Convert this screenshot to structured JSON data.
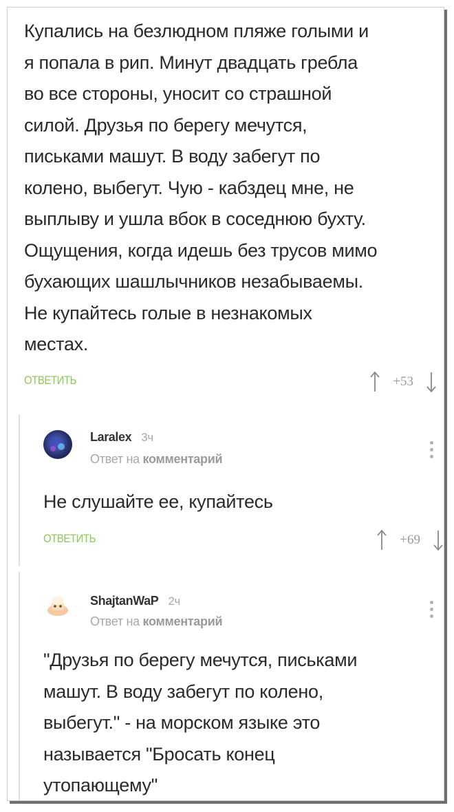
{
  "post": {
    "lines": [
      "Купались на безлюдном пляже голыми и",
      "я попала в рип. Минут двадцать гребла",
      "во все стороны, уносит со страшной",
      "силой. Друзья по берегу мечутся,",
      "письками машут.  В воду забегут по",
      "колено, выбегут.  Чую - кабздец мне, не",
      "выплыву и ушла вбок в соседнюю бухту.",
      "Ощущения, когда идешь без трусов мимо",
      "бухающих шашлычников незабываемы.",
      "Не купайтесь голые в незнакомых",
      "местах."
    ],
    "reply_label": "ОТВЕТИТЬ",
    "score": "+53"
  },
  "comments": [
    {
      "author": "Laralex",
      "time": "3ч",
      "reply_prefix": "Ответ на",
      "reply_target": "комментарий",
      "lines": [
        "Не слушайте ее, купайтесь"
      ],
      "reply_label": "ОТВЕТИТЬ",
      "score": "+69"
    },
    {
      "author": "ShajtanWaP",
      "time": "2ч",
      "reply_prefix": "Ответ на",
      "reply_target": "комментарий",
      "lines": [
        "\"Друзья по берегу мечутся, письками",
        "машут. В воду забегут по колено,",
        "выбегут.\" - на морском языке это",
        "называется \"Бросать конец",
        "утопающему\""
      ]
    }
  ],
  "colors": {
    "reply_link": "#8ac858",
    "text": "#2a2a2a",
    "muted": "#a8a8a8"
  },
  "icons": [
    "upvote-arrow-icon",
    "downvote-arrow-icon",
    "more-vertical-icon",
    "avatar-image"
  ]
}
